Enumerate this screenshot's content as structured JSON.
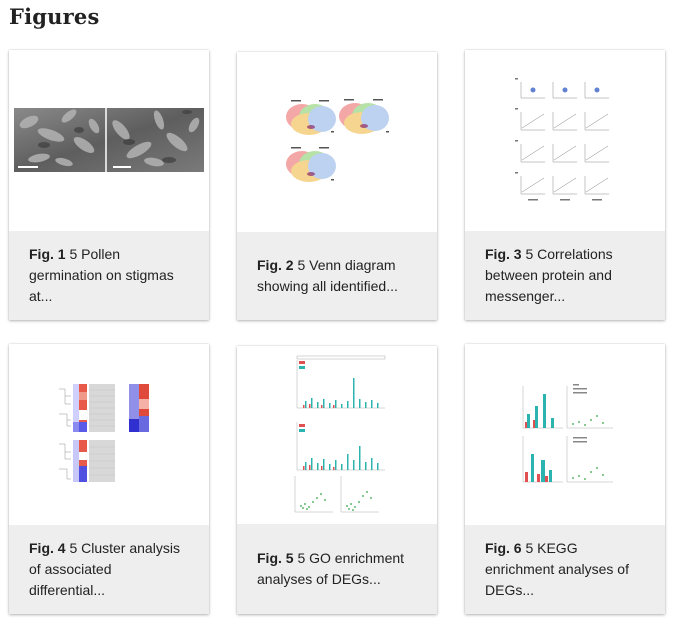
{
  "page": {
    "heading": "Figures"
  },
  "figures": [
    {
      "label": "Fig. 1",
      "text": " 5 Pollen germination on stigmas at..."
    },
    {
      "label": "Fig. 2",
      "text": " 5 Venn diagram showing all identified..."
    },
    {
      "label": "Fig. 3",
      "text": " 5 Correlations between protein and messenger..."
    },
    {
      "label": "Fig. 4",
      "text": " 5 Cluster analysis of associated differential..."
    },
    {
      "label": "Fig. 5",
      "text": " 5 GO enrichment analyses of DEGs..."
    },
    {
      "label": "Fig. 6",
      "text": " 5 KEGG enrichment analyses of DEGs..."
    }
  ]
}
